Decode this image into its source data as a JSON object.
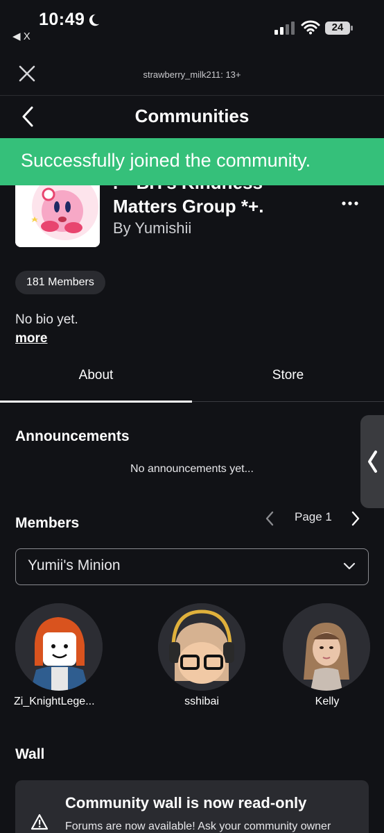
{
  "status_bar": {
    "time": "10:49",
    "back_app": "◀ X",
    "battery": "24"
  },
  "header": {
    "close_icon": "close-icon",
    "username_rating": "strawberry_milk211: 13+"
  },
  "nav": {
    "title": "Communities"
  },
  "toast": {
    "message": "Successfully joined the community.",
    "color": "#35c07a"
  },
  "group": {
    "name_line1": ".·° BH's Kindness",
    "name_line2": "Matters Group *+.",
    "owner": "By Yumishii",
    "members_chip": "181 Members",
    "bio": "No bio yet.",
    "more_link": "more"
  },
  "tabs": [
    {
      "label": "About",
      "active": true
    },
    {
      "label": "Store",
      "active": false
    }
  ],
  "announcements": {
    "title": "Announcements",
    "empty_text": "No announcements yet..."
  },
  "members": {
    "title": "Members",
    "page_label": "Page 1",
    "role_selected": "Yumii's Minion",
    "list": [
      {
        "name": "Zi_KnightLege..."
      },
      {
        "name": "sshibai"
      },
      {
        "name": "Kelly"
      }
    ]
  },
  "wall": {
    "title": "Wall",
    "notice_title": "Community wall is now read-only",
    "notice_body": "Forums are now available! Ask your community owner"
  }
}
